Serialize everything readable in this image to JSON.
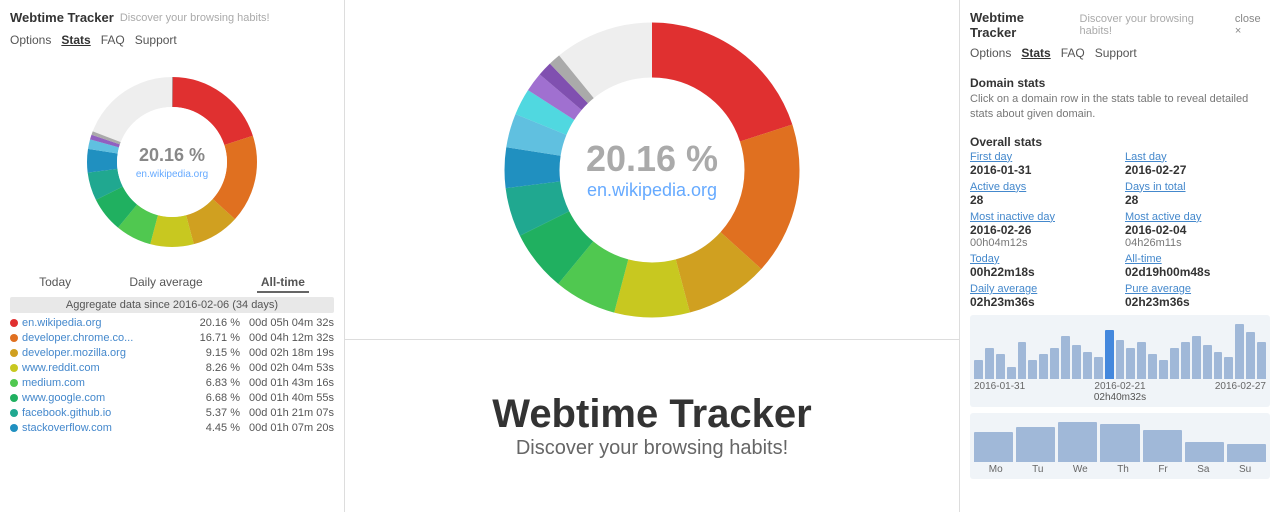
{
  "app": {
    "title": "Webtime Tracker",
    "subtitle": "Discover your browsing habits!"
  },
  "left": {
    "nav": [
      "Options",
      "Stats",
      "FAQ",
      "Support"
    ],
    "active_nav": "Stats",
    "donut": {
      "percent": "20.16 %",
      "domain": "en.wikipedia.org"
    },
    "tabs": [
      "Today",
      "Daily average",
      "All-time"
    ],
    "active_tab": "All-time",
    "aggregate": "Aggregate data since 2016-02-06 (34 days)",
    "domains": [
      {
        "color": "#e03030",
        "name": "en.wikipedia.org",
        "pct": "20.16 %",
        "time": "00d 05h 04m 32s"
      },
      {
        "color": "#e07020",
        "name": "developer.chrome.co...",
        "pct": "16.71 %",
        "time": "00d 04h 12m 32s"
      },
      {
        "color": "#d0a020",
        "name": "developer.mozilla.org",
        "pct": "9.15 %",
        "time": "00d 02h 18m 19s"
      },
      {
        "color": "#c8c820",
        "name": "www.reddit.com",
        "pct": "8.26 %",
        "time": "00d 02h 04m 53s"
      },
      {
        "color": "#50c850",
        "name": "medium.com",
        "pct": "6.83 %",
        "time": "00d 01h 43m 16s"
      },
      {
        "color": "#20b060",
        "name": "www.google.com",
        "pct": "6.68 %",
        "time": "00d 01h 40m 55s"
      },
      {
        "color": "#20a890",
        "name": "facebook.github.io",
        "pct": "5.37 %",
        "time": "00d 01h 21m 07s"
      },
      {
        "color": "#2090c0",
        "name": "stackoverflow.com",
        "pct": "4.45 %",
        "time": "00d 01h 07m 20s"
      }
    ]
  },
  "center": {
    "donut": {
      "percent": "20.16 %",
      "domain": "en.wikipedia.org"
    },
    "promo_title": "Webtime Tracker",
    "promo_subtitle": "Discover your browsing habits!"
  },
  "right": {
    "nav": [
      "Options",
      "Stats",
      "FAQ",
      "Support"
    ],
    "close_label": "close ×",
    "domain_stats_title": "Domain stats",
    "domain_stats_desc": "Click on a domain row in the stats table to reveal detailed stats about given domain.",
    "overall_stats_title": "Overall stats",
    "stats": {
      "first_day_label": "First day",
      "first_day_value": "2016-01-31",
      "last_day_label": "Last day",
      "last_day_value": "2016-02-27",
      "active_days_label": "Active days",
      "active_days_value": "28",
      "days_total_label": "Days in total",
      "days_total_value": "28",
      "most_inactive_label": "Most inactive day",
      "most_inactive_value": "2016-02-26",
      "most_inactive_sub": "00h04m12s",
      "most_active_label": "Most active day",
      "most_active_value": "2016-02-04",
      "most_active_sub": "04h26m11s",
      "today_label": "Today",
      "today_value": "00h22m18s",
      "alltime_label": "All-time",
      "alltime_value": "02d19h00m48s",
      "daily_avg_label": "Daily average",
      "daily_avg_value": "02h23m36s",
      "pure_avg_label": "Pure average",
      "pure_avg_value": "02h23m36s"
    },
    "daily_chart": {
      "labels": [
        "2016-01-31",
        "2016-02-21",
        "2016-02-27"
      ],
      "center_label": "02h40m32s",
      "bars": [
        15,
        25,
        20,
        10,
        30,
        15,
        20,
        25,
        35,
        28,
        22,
        18,
        40,
        32,
        25,
        30,
        20,
        15,
        25,
        30,
        35,
        28,
        22,
        18,
        45,
        38,
        30
      ]
    },
    "weekly_chart": {
      "labels": [
        "Mo",
        "Tu",
        "We",
        "Th",
        "Fr",
        "Sa",
        "Su"
      ],
      "bars": [
        30,
        35,
        40,
        38,
        32,
        20,
        18
      ]
    }
  }
}
